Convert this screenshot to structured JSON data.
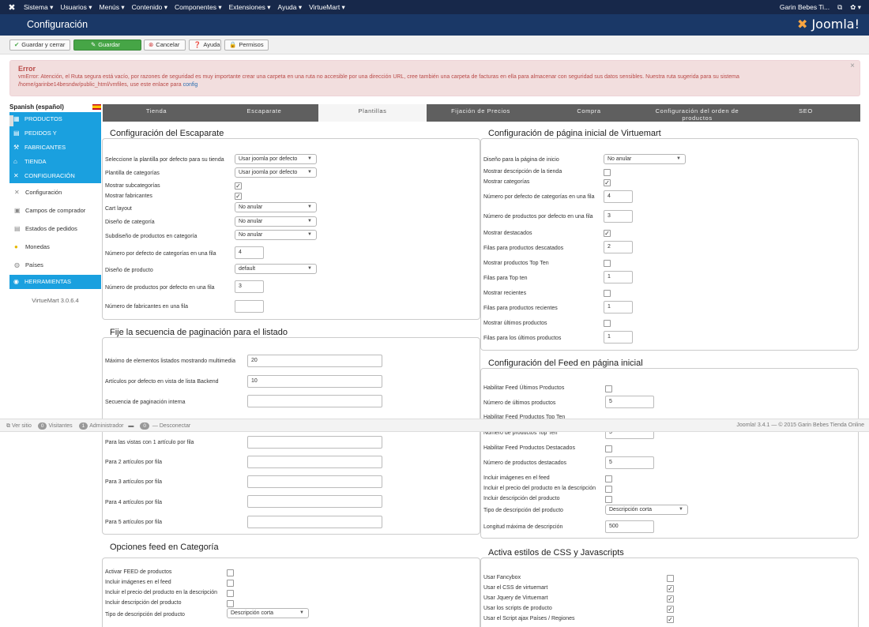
{
  "topbar": {
    "menu": [
      "Sistema ▾",
      "Usuarios ▾",
      "Menús ▾",
      "Contenido ▾",
      "Componentes ▾",
      "Extensiones ▾",
      "Ayuda ▾",
      "VirtueMart ▾"
    ],
    "user": "Garin Bebes Ti...",
    "settings": "✿ ▾"
  },
  "header": {
    "title": "Configuración",
    "brand": "Joomla!"
  },
  "toolbar": {
    "save_close": "Guardar y cerrar",
    "save": "Guardar",
    "cancel": "Cancelar",
    "help": "Ayuda",
    "permissions": "Permisos"
  },
  "error": {
    "title": "Error",
    "message": "vmError: Atención, el Ruta segura está vacío, por razones de seguridad es muy importante crear una carpeta en una ruta no accesible por una dirección URL, cree también una carpeta de facturas en ella para almacenar con seguridad sus datos sensibles. Nuestra ruta sugerida para su sistema /home/garinbe14besndw/public_html/vmfiles, use este enlace para",
    "link": "config"
  },
  "sidebar": {
    "language": "Spanish (español)",
    "sections": [
      "PRODUCTOS",
      "PEDIDOS Y",
      "FABRICANTES",
      "TIENDA",
      "CONFIGURACIÓN"
    ],
    "items": [
      "Configuración",
      "Campos de comprador",
      "Estados de pedidos",
      "Monedas",
      "Países"
    ],
    "tools": "HERRAMIENTAS",
    "version": "VirtueMart 3.0.6.4"
  },
  "tabs": [
    "Tienda",
    "Escaparate",
    "Plantillas",
    "Fijación de Precios",
    "Compra",
    "Configuración del orden de productos",
    "SEO"
  ],
  "escaparate": {
    "legend": "Configuración del Escaparate",
    "labels": [
      "Seleccione la plantilla por defecto para su tienda",
      "Plantilla de categorías",
      "Mostrar subcategorías",
      "Mostrar fabricantes",
      "Cart layout",
      "Diseño de categoría",
      "Subdiseño de productos en categoría",
      "Número por defecto de categorías en una fila",
      "Diseño de producto",
      "Número de productos por defecto en una fila",
      "Número de fabricantes en una fila"
    ],
    "values": [
      "Usar joomla por defecto",
      "Usar joomla por defecto",
      "No anular",
      "No anular",
      "No anular",
      "4",
      "default",
      "3",
      ""
    ]
  },
  "paginacion": {
    "legend": "Fije la secuencia de paginación para el listado",
    "labels": [
      "Máximo de elementos listados mostrando multimedia",
      "Artículos por defecto en vista de lista Backend",
      "Secuencia de paginación interna",
      "Para las vistas con 1 artículo por fila",
      "Para 2 artículos por fila",
      "Para 3 artículos por fila",
      "Para 4 artículos por fila",
      "Para 5 artículos por fila"
    ],
    "values": [
      "20",
      "10",
      "",
      "",
      "",
      "",
      "",
      ""
    ]
  },
  "feedcat": {
    "legend": "Opciones feed en Categoría",
    "labels": [
      "Activar FEED de productos",
      "Incluir imágenes en el feed",
      "Incluir el precio del producto en la descripción",
      "Incluir descripción del producto",
      "Tipo de descripción del producto"
    ],
    "select": "Descripción corta"
  },
  "inicio": {
    "legend": "Configuración de página inicial de Virtuemart",
    "labels": [
      "Diseño para la página de inicio",
      "Mostrar descripción de la tienda",
      "Mostrar categorías",
      "Número por defecto de categorías en una fila",
      "Número de productos por defecto en una fila",
      "Mostrar destacados",
      "Filas para productos descatados",
      "Mostrar productos Top Ten",
      "Filas para Top ten",
      "Mostrar recientes",
      "Filas para productos recientes",
      "Mostrar últimos productos",
      "Filas para los últimos productos"
    ],
    "select": "No anular",
    "values": [
      "4",
      "3",
      "2",
      "1",
      "1",
      "1"
    ]
  },
  "feedinicio": {
    "legend": "Configuración del Feed en página inicial",
    "labels": [
      "Habilitar Feed Últimos Productos",
      "Número de últimos productos",
      "Habilitar Feed Productos Top Ten",
      "Número de productos Top Ten",
      "Habilitar Feed Productos Destacados",
      "Número de productos destacados",
      "Incluir imágenes en el feed",
      "Incluir el precio del producto en la descripción",
      "Incluir descripción del producto",
      "Tipo de descripción del producto",
      "Longitud máxima de descripción"
    ],
    "values": [
      "5",
      "5",
      "5",
      "500"
    ],
    "select": "Descripción corta"
  },
  "css": {
    "legend": "Activa estilos de CSS y Javascripts",
    "labels": [
      "Usar Fancybox",
      "Usar el CSS de virtuemart",
      "Usar Jquery de Virtuemart",
      "Usar los scripts de producto",
      "Usar el Script ajax Países / Regiones"
    ]
  },
  "status": {
    "view_site": "Ver sitio",
    "visitors_count": "0",
    "visitors": "Visitantes",
    "admin_count": "1",
    "admin": "Administrador",
    "msg_count": "0",
    "logout": "Desconectar",
    "footer": "Joomla! 3.4.1 — © 2015 Garin Bebes Tienda Online"
  }
}
